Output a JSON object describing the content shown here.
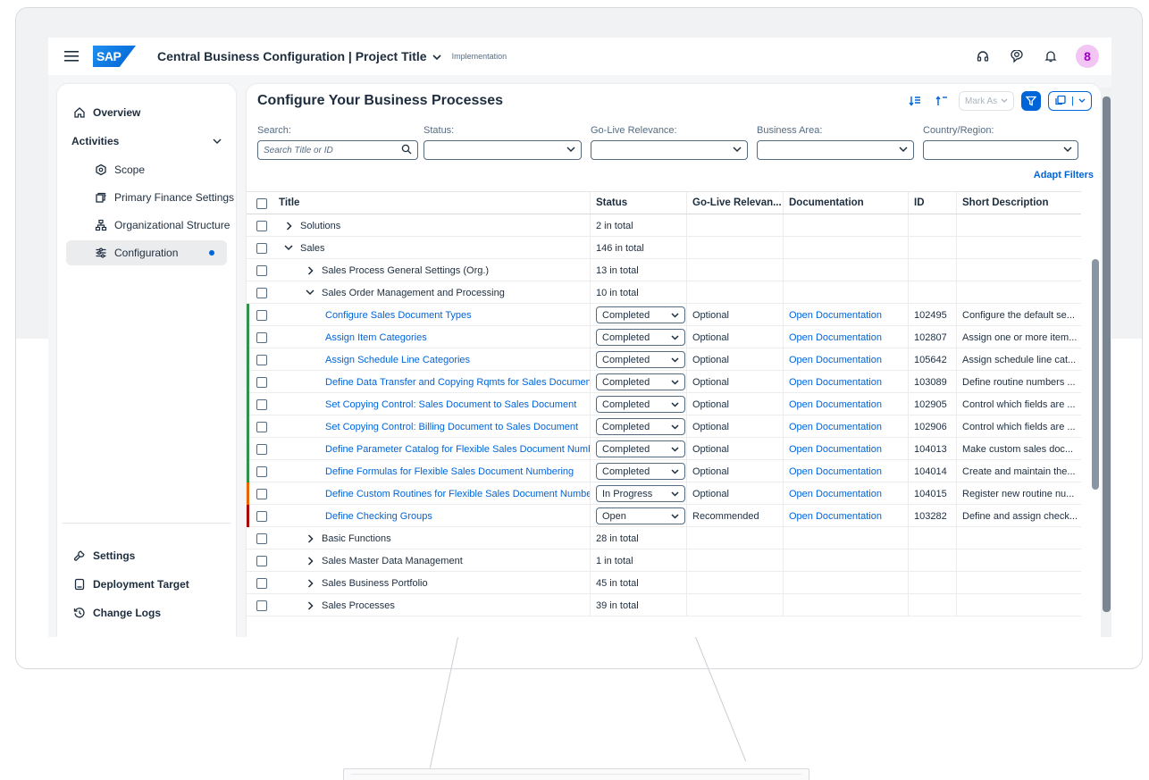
{
  "shell": {
    "title": "Central Business Configuration | Project Title",
    "subtitle": "Implementation",
    "logo_text": "SAP",
    "avatar_letter": "8"
  },
  "sidebar": {
    "overview": "Overview",
    "activities": "Activities",
    "items": [
      {
        "label": "Scope",
        "icon": "scope-icon"
      },
      {
        "label": "Primary Finance Settings",
        "icon": "finance-settings-icon"
      },
      {
        "label": "Organizational Structure",
        "icon": "org-structure-icon"
      },
      {
        "label": "Configuration",
        "icon": "configuration-icon"
      }
    ],
    "bottom": [
      {
        "label": "Settings",
        "icon": "settings-icon"
      },
      {
        "label": "Deployment Target",
        "icon": "deployment-target-icon"
      },
      {
        "label": "Change Logs",
        "icon": "change-logs-icon"
      }
    ]
  },
  "main": {
    "title": "Configure Your Business Processes",
    "mark_as": "Mark As",
    "adapt_filters": "Adapt Filters",
    "filters": {
      "search_label": "Search:",
      "search_placeholder": "Search Title or ID",
      "status_label": "Status:",
      "golive_label": "Go-Live Relevance:",
      "area_label": "Business Area:",
      "country_label": "Country/Region:"
    },
    "columns": {
      "title": "Title",
      "status": "Status",
      "golive": "Go-Live Relevan...",
      "doc": "Documentation",
      "id": "ID",
      "desc": "Short Description"
    },
    "rows": [
      {
        "title": "Solutions",
        "level": 1,
        "tw": "right",
        "status": "2 in total"
      },
      {
        "title": "Sales",
        "level": 1,
        "tw": "down",
        "status": "146 in total"
      },
      {
        "title": "Sales Process General Settings (Org.)",
        "level": 2,
        "tw": "right",
        "status": "13 in total"
      },
      {
        "title": "Sales Order Management and Processing",
        "level": 2,
        "tw": "down",
        "status": "10 in total"
      },
      {
        "title": "Configure Sales Document Types",
        "level": 3,
        "select": "Completed",
        "golive": "Optional",
        "doc": "Open Documentation",
        "id": "102495",
        "desc": "Configure the default se...",
        "bar": "#30914c"
      },
      {
        "title": "Assign Item Categories",
        "level": 3,
        "select": "Completed",
        "golive": "Optional",
        "doc": "Open Documentation",
        "id": "102807",
        "desc": "Assign one or more item...",
        "bar": "#30914c"
      },
      {
        "title": "Assign Schedule Line Categories",
        "level": 3,
        "select": "Completed",
        "golive": "Optional",
        "doc": "Open Documentation",
        "id": "105642",
        "desc": "Assign schedule line cat...",
        "bar": "#30914c"
      },
      {
        "title": "Define Data Transfer and Copying Rqmts for Sales Document",
        "level": 3,
        "select": "Completed",
        "golive": "Optional",
        "doc": "Open Documentation",
        "id": "103089",
        "desc": "Define routine numbers ...",
        "bar": "#30914c"
      },
      {
        "title": "Set Copying Control: Sales Document to Sales Document",
        "level": 3,
        "select": "Completed",
        "golive": "Optional",
        "doc": "Open Documentation",
        "id": "102905",
        "desc": "Control which fields are ...",
        "bar": "#30914c"
      },
      {
        "title": "Set Copying Control: Billing Document to Sales Document",
        "level": 3,
        "select": "Completed",
        "golive": "Optional",
        "doc": "Open Documentation",
        "id": "102906",
        "desc": "Control which fields are ...",
        "bar": "#30914c"
      },
      {
        "title": "Define Parameter Catalog for Flexible Sales Document Numberir",
        "level": 3,
        "select": "Completed",
        "golive": "Optional",
        "doc": "Open Documentation",
        "id": "104013",
        "desc": "Make custom sales doc...",
        "bar": "#30914c"
      },
      {
        "title": "Define Formulas for Flexible Sales Document Numbering",
        "level": 3,
        "select": "Completed",
        "golive": "Optional",
        "doc": "Open Documentation",
        "id": "104014",
        "desc": "Create and maintain the...",
        "bar": "#30914c"
      },
      {
        "title": "Define Custom Routines for Flexible Sales Document Numbering",
        "level": 3,
        "select": "In Progress",
        "golive": "Optional",
        "doc": "Open Documentation",
        "id": "104015",
        "desc": "Register new routine nu...",
        "bar": "#e76500"
      },
      {
        "title": "Define Checking Groups",
        "level": 3,
        "select": "Open",
        "golive": "Recommended",
        "doc": "Open Documentation",
        "id": "103282",
        "desc": "Define and assign check...",
        "bar": "#aa0808"
      },
      {
        "title": "Basic Functions",
        "level": 2,
        "tw": "right",
        "status": "28 in total"
      },
      {
        "title": "Sales Master Data Management",
        "level": 2,
        "tw": "right",
        "status": "1 in total"
      },
      {
        "title": "Sales Business Portfolio",
        "level": 2,
        "tw": "right",
        "status": "45 in total"
      },
      {
        "title": "Sales Processes",
        "level": 2,
        "tw": "right",
        "status": "39 in total"
      }
    ]
  },
  "colors": {
    "accent": "#0064d9",
    "completed": "#30914c",
    "in_progress": "#e76500",
    "open": "#aa0808"
  }
}
